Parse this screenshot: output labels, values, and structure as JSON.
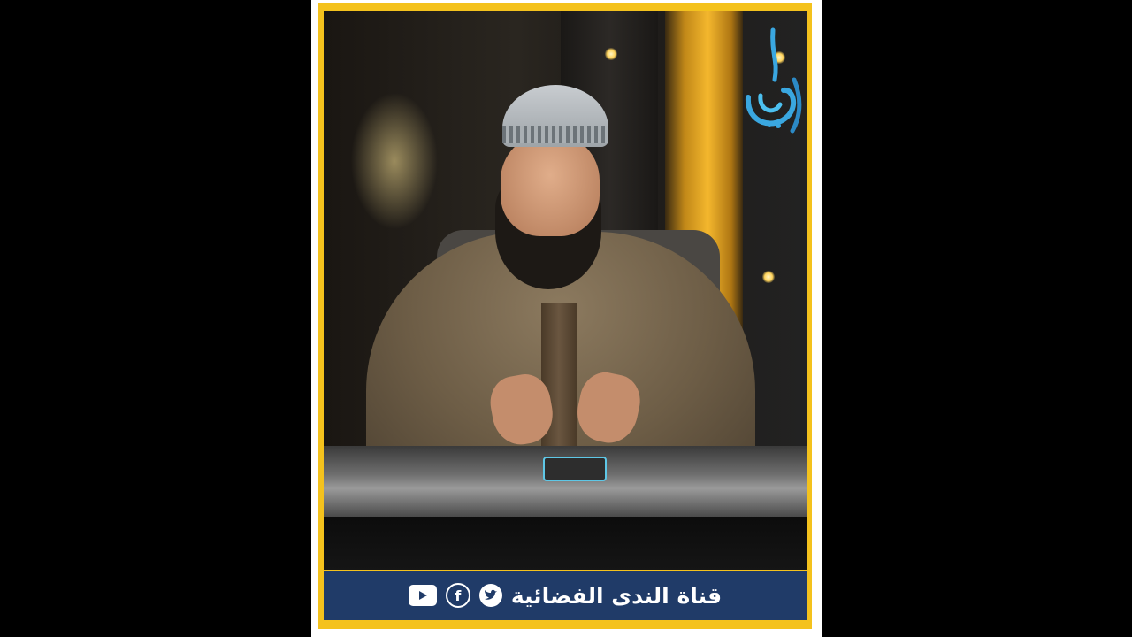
{
  "brand": {
    "channel_name": "قناة الندى الفضائية",
    "logo_text": "الندى",
    "accent_color": "#f4c21d",
    "bar_color": "#203b68",
    "logo_color": "#3aa7e0"
  },
  "icons": [
    "twitter-icon",
    "facebook-icon",
    "youtube-icon"
  ]
}
